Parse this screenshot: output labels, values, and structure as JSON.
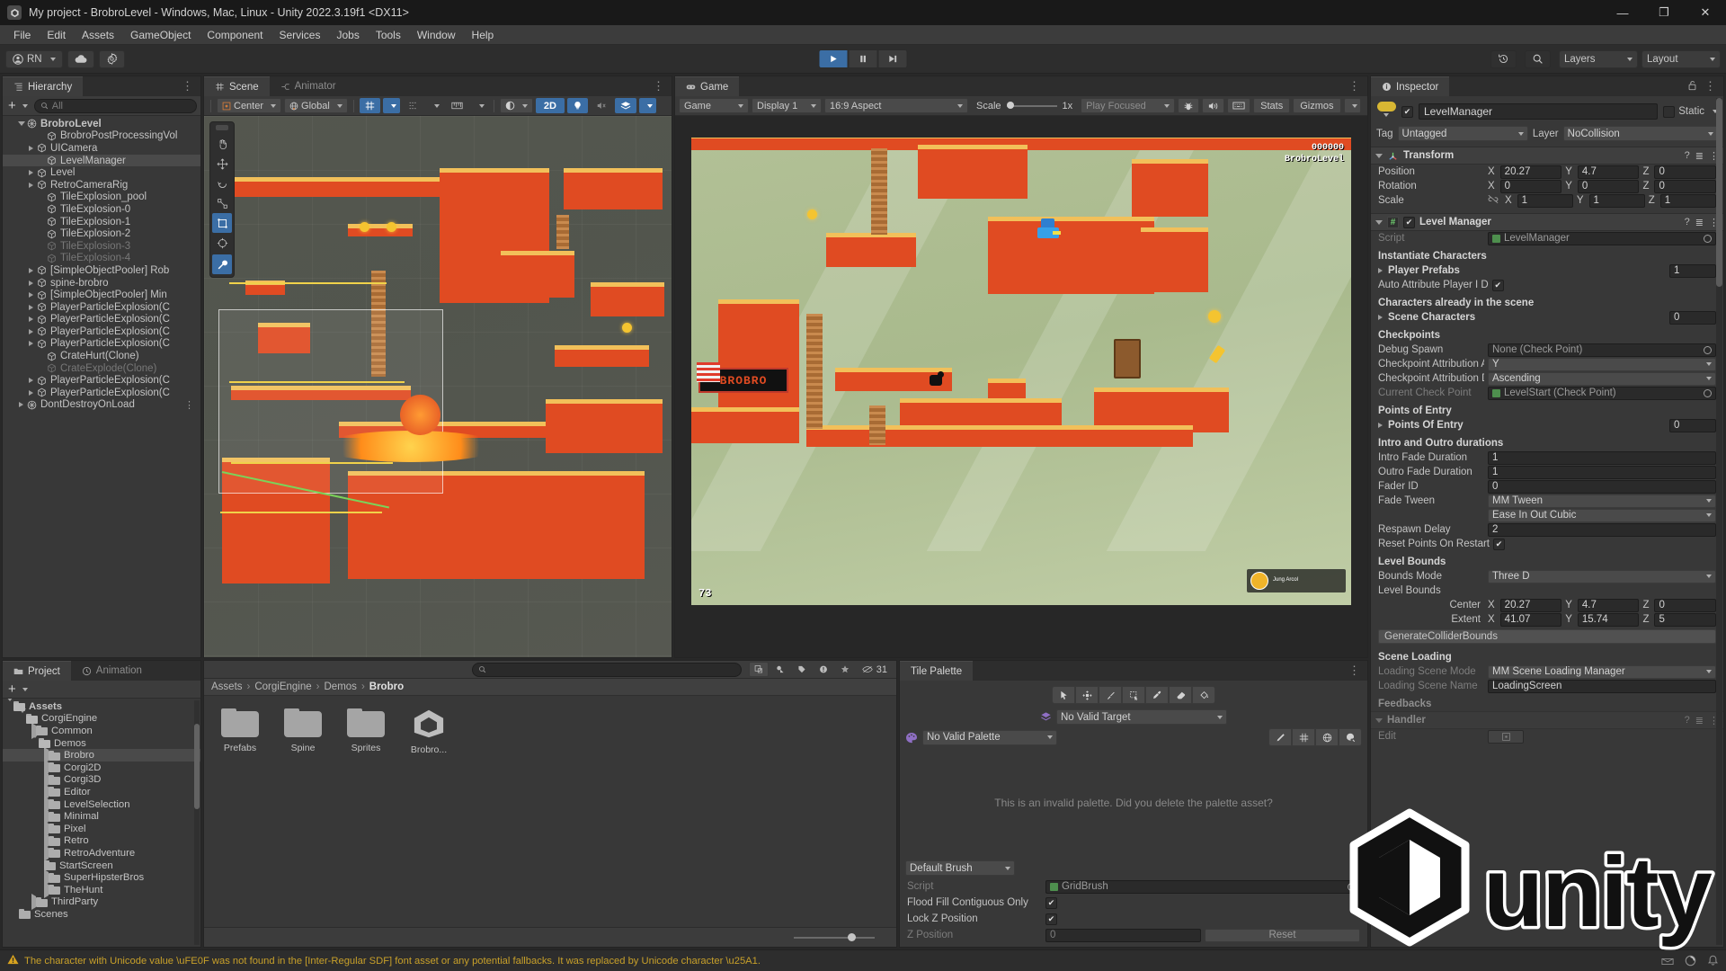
{
  "window": {
    "title": "My project - BrobroLevel - Windows, Mac, Linux - Unity 2022.3.19f1 <DX11>",
    "minimize": "—",
    "maximize": "❐",
    "close": "✕"
  },
  "menu": [
    "File",
    "Edit",
    "Assets",
    "GameObject",
    "Component",
    "Services",
    "Jobs",
    "Tools",
    "Window",
    "Help"
  ],
  "toolbar": {
    "account_label": "RN",
    "cloud_icon": "cloud-icon",
    "settings_icon": "gear-icon",
    "play_icon": "play-icon",
    "pause_icon": "pause-icon",
    "step_icon": "step-icon",
    "history_icon": "history-icon",
    "search_icon": "search-icon",
    "layers_label": "Layers",
    "layout_label": "Layout"
  },
  "hierarchy": {
    "tab_label": "Hierarchy",
    "add_label": "+",
    "search_placeholder": "All",
    "items": [
      {
        "label": "BrobroLevel",
        "depth": 1,
        "twisty": "open",
        "icon": "scene-icon",
        "dim": false,
        "selected": false,
        "bold": true
      },
      {
        "label": "BrobroPostProcessingVol",
        "depth": 3,
        "twisty": "none",
        "icon": "cube-icon",
        "dim": false,
        "selected": false
      },
      {
        "label": "UICamera",
        "depth": 2,
        "twisty": "closed",
        "icon": "cube-icon",
        "dim": false,
        "selected": false
      },
      {
        "label": "LevelManager",
        "depth": 3,
        "twisty": "none",
        "icon": "cube-icon",
        "dim": false,
        "selected": true
      },
      {
        "label": "Level",
        "depth": 2,
        "twisty": "closed",
        "icon": "cube-icon",
        "dim": false,
        "selected": false
      },
      {
        "label": "RetroCameraRig",
        "depth": 2,
        "twisty": "closed",
        "icon": "cube-icon",
        "dim": false,
        "selected": false
      },
      {
        "label": "TileExplosion_pool",
        "depth": 3,
        "twisty": "none",
        "icon": "cube-icon",
        "dim": false,
        "selected": false
      },
      {
        "label": "TileExplosion-0",
        "depth": 3,
        "twisty": "none",
        "icon": "cube-icon",
        "dim": false,
        "selected": false
      },
      {
        "label": "TileExplosion-1",
        "depth": 3,
        "twisty": "none",
        "icon": "cube-icon",
        "dim": false,
        "selected": false
      },
      {
        "label": "TileExplosion-2",
        "depth": 3,
        "twisty": "none",
        "icon": "cube-icon",
        "dim": false,
        "selected": false
      },
      {
        "label": "TileExplosion-3",
        "depth": 3,
        "twisty": "none",
        "icon": "cube-icon",
        "dim": true,
        "selected": false
      },
      {
        "label": "TileExplosion-4",
        "depth": 3,
        "twisty": "none",
        "icon": "cube-icon",
        "dim": true,
        "selected": false
      },
      {
        "label": "[SimpleObjectPooler] Rob",
        "depth": 2,
        "twisty": "closed",
        "icon": "cube-icon",
        "dim": false,
        "selected": false
      },
      {
        "label": "spine-brobro",
        "depth": 2,
        "twisty": "closed",
        "icon": "cube-icon",
        "dim": false,
        "selected": false
      },
      {
        "label": "[SimpleObjectPooler] Min",
        "depth": 2,
        "twisty": "closed",
        "icon": "cube-icon",
        "dim": false,
        "selected": false
      },
      {
        "label": "PlayerParticleExplosion(C",
        "depth": 2,
        "twisty": "closed",
        "icon": "cube-icon",
        "dim": false,
        "selected": false
      },
      {
        "label": "PlayerParticleExplosion(C",
        "depth": 2,
        "twisty": "closed",
        "icon": "cube-icon",
        "dim": false,
        "selected": false
      },
      {
        "label": "PlayerParticleExplosion(C",
        "depth": 2,
        "twisty": "closed",
        "icon": "cube-icon",
        "dim": false,
        "selected": false
      },
      {
        "label": "PlayerParticleExplosion(C",
        "depth": 2,
        "twisty": "closed",
        "icon": "cube-icon",
        "dim": false,
        "selected": false
      },
      {
        "label": "CrateHurt(Clone)",
        "depth": 3,
        "twisty": "none",
        "icon": "cube-icon",
        "dim": false,
        "selected": false
      },
      {
        "label": "CrateExplode(Clone)",
        "depth": 3,
        "twisty": "none",
        "icon": "cube-icon",
        "dim": true,
        "selected": false
      },
      {
        "label": "PlayerParticleExplosion(C",
        "depth": 2,
        "twisty": "closed",
        "icon": "cube-icon",
        "dim": false,
        "selected": false
      },
      {
        "label": "PlayerParticleExplosion(C",
        "depth": 2,
        "twisty": "closed",
        "icon": "cube-icon",
        "dim": false,
        "selected": false
      },
      {
        "label": "DontDestroyOnLoad",
        "depth": 1,
        "twisty": "closed",
        "icon": "scene-icon",
        "dim": false,
        "selected": false,
        "hasMore": true
      }
    ]
  },
  "scene": {
    "tab_label": "Scene",
    "animator_tab_label": "Animator",
    "pivot_label": "Center",
    "space_label": "Global",
    "two_d_label": "2D",
    "grid_icon": "grid-icon",
    "snap_icon": "snap-icon",
    "ruler_icon": "ruler-icon",
    "lighting_icon": "lighting-icon",
    "light_icon": "light-bulb-icon",
    "audio_icon": "audio-mute-icon",
    "fx_icon": "effects-icon",
    "tools": [
      "hand-tool",
      "move-tool",
      "rotate-tool",
      "scale-tool",
      "rect-tool",
      "transform-tool",
      "custom-tool"
    ]
  },
  "game": {
    "tab_label": "Game",
    "target_label": "Game",
    "display_label": "Display 1",
    "aspect_label": "16:9 Aspect",
    "scale_label": "Scale",
    "scale_value": "1x",
    "play_focused_label": "Play Focused",
    "stats_label": "Stats",
    "gizmos_label": "Gizmos",
    "mute_icon": "audio-icon",
    "debug_icon": "bug-icon",
    "stats_icon": "keyboard-icon",
    "hud_score": "000000",
    "hud_level": "BrobroLevel",
    "hud_counter": "73",
    "hud_avatar_name": "Jung Arcol"
  },
  "inspector": {
    "tab_label": "Inspector",
    "lock_icon": "lock-icon",
    "object_name": "LevelManager",
    "enabled": true,
    "static_label": "Static",
    "tag_label": "Tag",
    "tag_value": "Untagged",
    "layer_label": "Layer",
    "layer_value": "NoCollision",
    "transform": {
      "title": "Transform",
      "rows": [
        {
          "name": "Position",
          "x": "20.27",
          "y": "4.7",
          "z": "0"
        },
        {
          "name": "Rotation",
          "x": "0",
          "y": "0",
          "z": "0"
        },
        {
          "name": "Scale",
          "x": "1",
          "y": "1",
          "z": "1",
          "link_icon": "unlink-icon"
        }
      ]
    },
    "level_manager": {
      "title": "Level Manager",
      "enabled": true,
      "script_label": "Script",
      "script_value": "LevelManager",
      "sections": {
        "instantiate_characters": "Instantiate Characters",
        "player_prefabs_label": "Player Prefabs",
        "player_prefabs_value": "1",
        "auto_attribute_label": "Auto Attribute Player I D",
        "auto_attribute_checked": true,
        "characters_in_scene": "Characters already in the scene",
        "scene_characters_label": "Scene Characters",
        "scene_characters_value": "0",
        "checkpoints": "Checkpoints",
        "debug_spawn_label": "Debug Spawn",
        "debug_spawn_value": "None (Check Point)",
        "cp_attr_axis_label": "Checkpoint Attribution A",
        "cp_attr_axis_value": "Y",
        "cp_attr_dir_label": "Checkpoint Attribution D",
        "cp_attr_dir_value": "Ascending",
        "current_cp_label": "Current Check Point",
        "current_cp_value": "LevelStart (Check Point)",
        "points_of_entry": "Points of Entry",
        "points_of_entry_label": "Points Of Entry",
        "points_of_entry_value": "0",
        "intro_outro": "Intro and Outro durations",
        "intro_fade_label": "Intro Fade Duration",
        "intro_fade_value": "1",
        "outro_fade_label": "Outro Fade Duration",
        "outro_fade_value": "1",
        "fader_id_label": "Fader ID",
        "fader_id_value": "0",
        "fade_tween_label": "Fade Tween",
        "fade_tween_value": "MM Tween",
        "fade_curve_value": "Ease In Out Cubic",
        "respawn_delay_label": "Respawn Delay",
        "respawn_delay_value": "2",
        "reset_points_label": "Reset Points On Restart",
        "reset_points_checked": true,
        "level_bounds": "Level Bounds",
        "bounds_mode_label": "Bounds Mode",
        "bounds_mode_value": "Three D",
        "level_bounds_label": "Level Bounds",
        "center_label": "Center",
        "center_x": "20.27",
        "center_y": "4.7",
        "center_z": "0",
        "extent_label": "Extent",
        "extent_x": "41.07",
        "extent_y": "15.74",
        "extent_z": "5",
        "generate_collider_button": "GenerateColliderBounds",
        "scene_loading": "Scene Loading",
        "loading_mode_label": "Loading Scene Mode",
        "loading_mode_value": "MM Scene Loading Manager",
        "loading_name_label": "Loading Scene Name",
        "loading_name_value": "LoadingScreen",
        "feedbacks_label": "Feedbacks",
        "handler_label": "Handler",
        "edit_label": "Edit"
      }
    }
  },
  "project": {
    "tab_label": "Project",
    "animation_tab_label": "Animation",
    "add_label": "+",
    "search_placeholder": "",
    "item_count": "31",
    "breadcrumbs": [
      "Assets",
      "CorgiEngine",
      "Demos",
      "Brobro"
    ],
    "tree": [
      {
        "label": "Assets",
        "depth": 0,
        "twisty": "open",
        "icon": "folder-open",
        "selected": false,
        "bold": true
      },
      {
        "label": "CorgiEngine",
        "depth": 1,
        "twisty": "open",
        "icon": "folder-open",
        "selected": false
      },
      {
        "label": "Common",
        "depth": 2,
        "twisty": "closed",
        "icon": "folder",
        "selected": false
      },
      {
        "label": "Demos",
        "depth": 2,
        "twisty": "open",
        "icon": "folder-open",
        "selected": false
      },
      {
        "label": "Brobro",
        "depth": 3,
        "twisty": "closed",
        "icon": "folder",
        "selected": true
      },
      {
        "label": "Corgi2D",
        "depth": 3,
        "twisty": "closed",
        "icon": "folder",
        "selected": false
      },
      {
        "label": "Corgi3D",
        "depth": 3,
        "twisty": "closed",
        "icon": "folder",
        "selected": false
      },
      {
        "label": "Editor",
        "depth": 3,
        "twisty": "closed",
        "icon": "folder",
        "selected": false
      },
      {
        "label": "LevelSelection",
        "depth": 3,
        "twisty": "closed",
        "icon": "folder",
        "selected": false
      },
      {
        "label": "Minimal",
        "depth": 3,
        "twisty": "closed",
        "icon": "folder",
        "selected": false
      },
      {
        "label": "Pixel",
        "depth": 3,
        "twisty": "closed",
        "icon": "folder",
        "selected": false
      },
      {
        "label": "Retro",
        "depth": 3,
        "twisty": "closed",
        "icon": "folder",
        "selected": false
      },
      {
        "label": "RetroAdventure",
        "depth": 3,
        "twisty": "closed",
        "icon": "folder",
        "selected": false
      },
      {
        "label": "StartScreen",
        "depth": 3,
        "twisty": "none",
        "icon": "folder",
        "selected": false
      },
      {
        "label": "SuperHipsterBros",
        "depth": 3,
        "twisty": "closed",
        "icon": "folder",
        "selected": false
      },
      {
        "label": "TheHunt",
        "depth": 3,
        "twisty": "closed",
        "icon": "folder",
        "selected": false
      },
      {
        "label": "ThirdParty",
        "depth": 2,
        "twisty": "closed",
        "icon": "folder",
        "selected": false
      },
      {
        "label": "Scenes",
        "depth": 1,
        "twisty": "none",
        "icon": "folder",
        "selected": false
      }
    ],
    "grid_items": [
      {
        "label": "Prefabs",
        "kind": "folder"
      },
      {
        "label": "Spine",
        "kind": "folder"
      },
      {
        "label": "Sprites",
        "kind": "folder"
      },
      {
        "label": "Brobro...",
        "kind": "unity-asset"
      }
    ]
  },
  "tile_palette": {
    "tab_label": "Tile Palette",
    "tools": [
      "select-tool",
      "move-tool",
      "brush-tool",
      "box-fill-tool",
      "picker-tool",
      "eraser-tool",
      "paint-bucket-tool"
    ],
    "target_value": "No Valid Target",
    "palette_value": "No Valid Palette",
    "edit_icon": "pencil-icon",
    "grid_icon": "grid-icon",
    "gizmo_icon": "globe-icon",
    "settings_icon": "palette-settings-icon",
    "empty_message": "This is an invalid palette. Did you delete the palette asset?",
    "brush_value": "Default Brush",
    "script_label": "Script",
    "script_value": "GridBrush",
    "flood_fill_label": "Flood Fill Contiguous Only",
    "flood_fill_checked": true,
    "lock_z_label": "Lock Z Position",
    "lock_z_checked": true,
    "z_position_label": "Z Position",
    "z_position_value": "0",
    "reset_label": "Reset"
  },
  "status": {
    "warning_icon": "warning-icon",
    "message": "The character with Unicode value \\uFE0F was not found in the [Inter-Regular SDF] font asset or any potential fallbacks. It was replaced by Unicode character \\u25A1."
  },
  "colors": {
    "accent_blue": "#3b6ea5",
    "warning_yellow": "#c8a02a",
    "panel_bg": "#383838",
    "toolbar_bg": "#2d2d2d",
    "terrain_red": "#e04b22",
    "terrain_top": "#f2c05a"
  }
}
